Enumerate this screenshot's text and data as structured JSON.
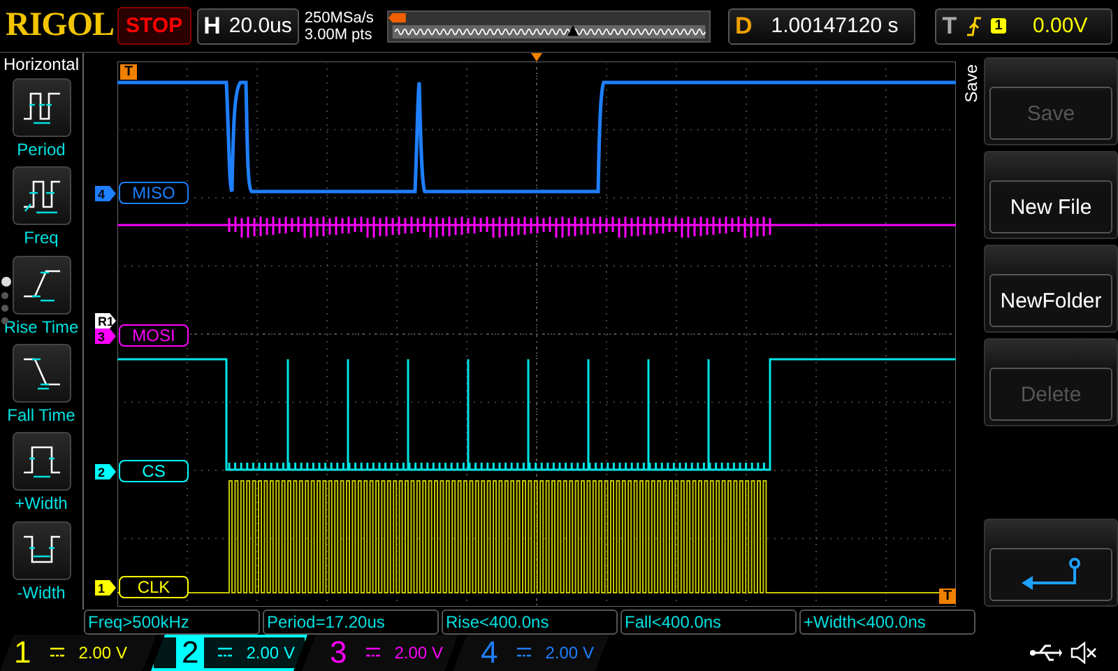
{
  "brand": "RIGOL",
  "run_state": "STOP",
  "horizontal": {
    "label": "H",
    "timebase": "20.0us",
    "sample_rate": "250MSa/s",
    "memory_depth": "3.00M pts"
  },
  "delay": {
    "label": "D",
    "value": "1.00147120 s"
  },
  "trigger": {
    "label": "T",
    "source": "1",
    "level": "0.00V"
  },
  "left_menu": {
    "title": "Horizontal",
    "items": [
      {
        "kind": "period",
        "label": "Period"
      },
      {
        "kind": "freq",
        "label": "Freq"
      },
      {
        "kind": "rise",
        "label": "Rise Time"
      },
      {
        "kind": "fall",
        "label": "Fall Time"
      },
      {
        "kind": "pwidth",
        "label": "+Width"
      },
      {
        "kind": "nwidth",
        "label": "-Width"
      }
    ],
    "pages": [
      {
        "selected": true
      },
      {
        "selected": false
      },
      {
        "selected": false
      },
      {
        "selected": false
      }
    ]
  },
  "right_menu": {
    "title": "Save",
    "buttons": [
      {
        "kind": "text",
        "label": "Save",
        "disabled": true
      },
      {
        "kind": "text",
        "label": "New File",
        "disabled": false
      },
      {
        "kind": "text",
        "label": "NewFolder",
        "disabled": false
      },
      {
        "kind": "text",
        "label": "Delete",
        "disabled": true
      },
      {
        "kind": "return",
        "disabled": false
      }
    ]
  },
  "grid_markers": {
    "trigger_position": "T",
    "trigger_level": "T"
  },
  "channel_labels": [
    {
      "marker": "4",
      "name": "MISO",
      "color": "#1e7fff"
    },
    {
      "marker": "3",
      "name": "MOSI",
      "color": "#ff00ff",
      "ref_marker": "R1"
    },
    {
      "marker": "2",
      "name": "CS",
      "color": "#00ffff"
    },
    {
      "marker": "1",
      "name": "CLK",
      "color": "#ffff00"
    }
  ],
  "measurements": [
    "Freq>500kHz",
    "Period=17.20us",
    "Rise<400.0ns",
    "Fall<400.0ns",
    "+Width<400.0ns"
  ],
  "channels": [
    {
      "number": "1",
      "scale": "2.00 V",
      "selected": false,
      "color": "#ffff00"
    },
    {
      "number": "2",
      "scale": "2.00 V",
      "selected": true,
      "color": "#00ffff"
    },
    {
      "number": "3",
      "scale": "2.00 V",
      "selected": false,
      "color": "#ff00ff"
    },
    {
      "number": "4",
      "scale": "2.00 V",
      "selected": false,
      "color": "#1e7fff"
    }
  ]
}
